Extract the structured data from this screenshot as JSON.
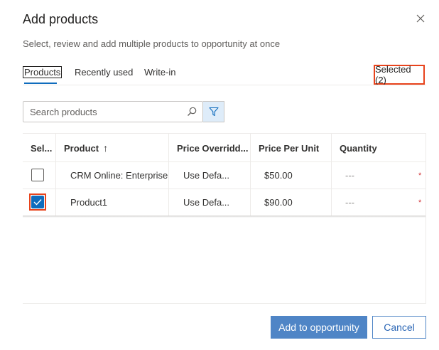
{
  "dialog": {
    "title": "Add products",
    "subtitle": "Select, review and add multiple products to opportunity at once",
    "close_icon": "close-icon"
  },
  "tabs": [
    {
      "label": "Products",
      "active": true
    },
    {
      "label": "Recently used",
      "active": false
    },
    {
      "label": "Write-in",
      "active": false
    }
  ],
  "selected_label": "Selected (2)",
  "search": {
    "placeholder": "Search products",
    "value": "",
    "icon": "search-icon"
  },
  "filter": {
    "icon": "filter-icon"
  },
  "table": {
    "columns": [
      "Sel...",
      "Product",
      "Price Overridd...",
      "Price Per Unit",
      "Quantity"
    ],
    "sort_indicator": "↑",
    "rows": [
      {
        "selected": false,
        "product": "CRM Online: Enterprise (",
        "price_override": "Use Defa...",
        "price_per_unit": "$50.00",
        "quantity": "---",
        "required_mark": "*"
      },
      {
        "selected": true,
        "product": "Product1",
        "price_override": "Use Defa...",
        "price_per_unit": "$90.00",
        "quantity": "---",
        "required_mark": "*"
      }
    ]
  },
  "footer": {
    "primary_label": "Add to opportunity",
    "secondary_label": "Cancel"
  },
  "colors": {
    "accent": "#0f6cbd",
    "primary_button": "#4f85c6",
    "highlight": "#e8431c",
    "required": "#d13438"
  }
}
